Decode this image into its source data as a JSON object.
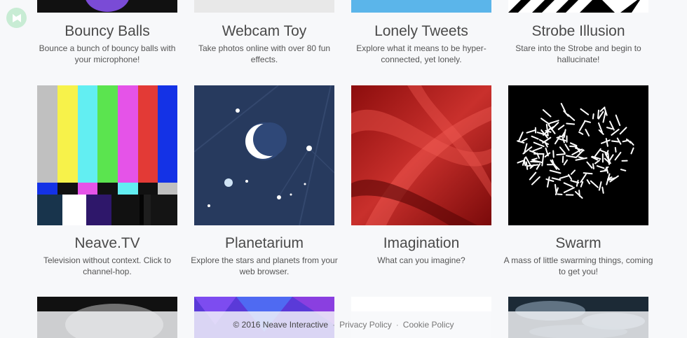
{
  "row1": [
    {
      "title": "Bouncy Balls",
      "desc": "Bounce a bunch of bouncy balls with your microphone!"
    },
    {
      "title": "Webcam Toy",
      "desc": "Take photos online with over 80 fun effects."
    },
    {
      "title": "Lonely Tweets",
      "desc": "Explore what it means to be hyper-connected, yet lonely."
    },
    {
      "title": "Strobe Illusion",
      "desc": "Stare into the Strobe and begin to hallucinate!"
    }
  ],
  "row2": [
    {
      "title": "Neave.TV",
      "desc": "Television without context. Click to channel-hop."
    },
    {
      "title": "Planetarium",
      "desc": "Explore the stars and planets from your web browser."
    },
    {
      "title": "Imagination",
      "desc": "What can you imagine?"
    },
    {
      "title": "Swarm",
      "desc": "A mass of little swarming things, coming to get you!"
    }
  ],
  "footer": {
    "copyright": "© 2016 Neave Interactive",
    "separator": "·",
    "privacy": "Privacy Policy",
    "cookie": "Cookie Policy"
  },
  "icons": {
    "logo": "neave-logo-icon"
  },
  "colors": {
    "background": "#f7f8fa",
    "tweets_blue": "#5bb5ea",
    "planetarium_navy": "#273a5e",
    "imagination_red": "#b51e1e"
  }
}
